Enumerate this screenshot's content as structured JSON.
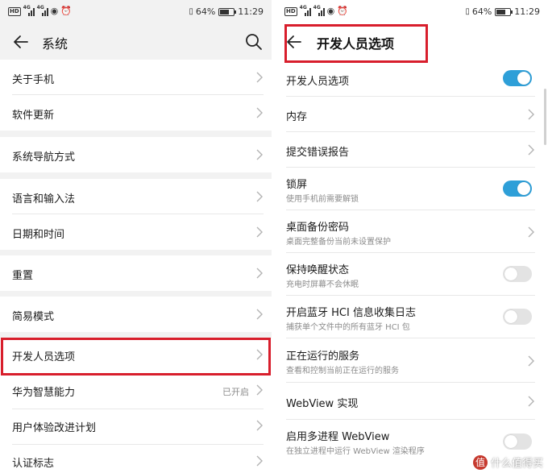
{
  "left": {
    "status": {
      "hd": "HD",
      "net1": "4G",
      "net2": "4G",
      "battery_percent": "64%",
      "battery_level": 0.64,
      "time": "11:29"
    },
    "title": "系统",
    "groups": [
      {
        "items": [
          {
            "label": "关于手机"
          },
          {
            "label": "软件更新"
          }
        ]
      },
      {
        "items": [
          {
            "label": "系统导航方式"
          }
        ]
      },
      {
        "items": [
          {
            "label": "语言和输入法"
          },
          {
            "label": "日期和时间"
          }
        ]
      },
      {
        "items": [
          {
            "label": "重置"
          }
        ]
      },
      {
        "items": [
          {
            "label": "简易模式"
          }
        ]
      },
      {
        "items": [
          {
            "label": "开发人员选项"
          },
          {
            "label": "华为智慧能力",
            "value": "已开启"
          },
          {
            "label": "用户体验改进计划"
          },
          {
            "label": "认证标志"
          }
        ]
      }
    ]
  },
  "right": {
    "status": {
      "hd": "HD",
      "net1": "4G",
      "net2": "4G",
      "battery_percent": "64%",
      "battery_level": 0.64,
      "time": "11:29"
    },
    "title": "开发人员选项",
    "items": [
      {
        "label": "开发人员选项",
        "toggle": true
      },
      {
        "label": "内存"
      },
      {
        "label": "提交错误报告"
      },
      {
        "label": "锁屏",
        "sub": "使用手机前需要解锁",
        "toggle": true
      },
      {
        "label": "桌面备份密码",
        "sub": "桌面完整备份当前未设置保护"
      },
      {
        "label": "保持唤醒状态",
        "sub": "充电时屏幕不会休眠",
        "toggle": false
      },
      {
        "label": "开启蓝牙 HCI 信息收集日志",
        "sub": "捕获单个文件中的所有蓝牙 HCI 包",
        "toggle": false
      },
      {
        "label": "正在运行的服务",
        "sub": "查看和控制当前正在运行的服务"
      },
      {
        "label": "WebView 实现"
      },
      {
        "label": "启用多进程 WebView",
        "sub": "在独立进程中运行 WebView 渲染程序",
        "toggle": false
      }
    ]
  },
  "watermark": {
    "logo": "值",
    "text": "什么值得买"
  },
  "colors": {
    "accent": "#2e9fd8",
    "highlight": "#d81e2c",
    "background": "#f2f2f2"
  },
  "icons": {
    "back": "arrow-left-icon",
    "search": "magnifier-icon",
    "chevron": "chevron-right-icon"
  }
}
